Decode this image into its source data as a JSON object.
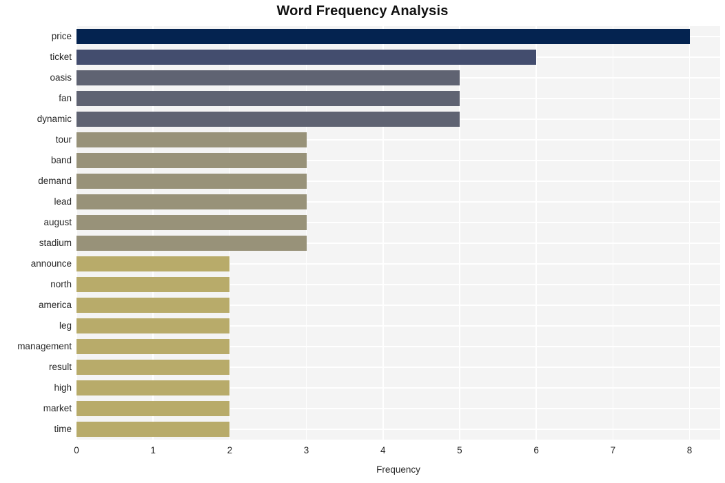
{
  "chart_data": {
    "type": "bar",
    "orientation": "horizontal",
    "title": "Word Frequency Analysis",
    "xlabel": "Frequency",
    "ylabel": "",
    "categories": [
      "price",
      "ticket",
      "oasis",
      "fan",
      "dynamic",
      "tour",
      "band",
      "demand",
      "lead",
      "august",
      "stadium",
      "announce",
      "north",
      "america",
      "leg",
      "management",
      "result",
      "high",
      "market",
      "time"
    ],
    "values": [
      8,
      6,
      5,
      5,
      5,
      3,
      3,
      3,
      3,
      3,
      3,
      2,
      2,
      2,
      2,
      2,
      2,
      2,
      2,
      2
    ],
    "bar_colors": [
      "#042350",
      "#434d6e",
      "#5f6372",
      "#5f6372",
      "#5f6372",
      "#989279",
      "#989279",
      "#989279",
      "#989279",
      "#989279",
      "#989279",
      "#b8ab6a",
      "#b8ab6a",
      "#b8ab6a",
      "#b8ab6a",
      "#b8ab6a",
      "#b8ab6a",
      "#b8ab6a",
      "#b8ab6a",
      "#b8ab6a"
    ],
    "xlim": [
      0,
      8.4
    ],
    "xticks": [
      0,
      1,
      2,
      3,
      4,
      5,
      6,
      7,
      8
    ],
    "xtick_labels": [
      "0",
      "1",
      "2",
      "3",
      "4",
      "5",
      "6",
      "7",
      "8"
    ],
    "grid": true,
    "legend": false,
    "plot_background": "#f4f4f4",
    "grid_color": "#ffffff",
    "figure_background": "#ffffff",
    "title_color": "#111111",
    "tick_label_color": "#262626"
  }
}
